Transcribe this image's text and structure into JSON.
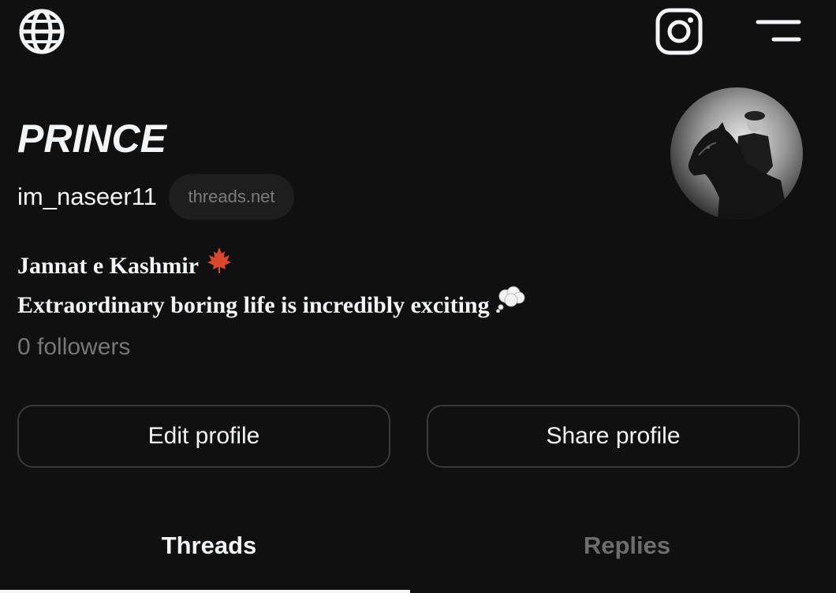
{
  "header": {
    "left_icon": "globe-icon",
    "right_icons": [
      "instagram-icon",
      "menu-icon"
    ]
  },
  "profile": {
    "display_name": "PRINCE",
    "username": "im_naseer11",
    "domain_badge": "threads.net",
    "bio_line1": "Jannat e Kashmir",
    "bio_line1_icon": "maple-leaf-icon",
    "bio_line2": "Extraordinary boring life is incredibly exciting",
    "bio_line2_icon": "thought-balloon-icon",
    "followers": "0 followers"
  },
  "buttons": {
    "edit_label": "Edit profile",
    "share_label": "Share profile"
  },
  "tabs": [
    {
      "label": "Threads",
      "active": true
    },
    {
      "label": "Replies",
      "active": false
    }
  ],
  "colors": {
    "background": "#101010",
    "text": "#f3f5f7",
    "muted": "#777777",
    "border": "#3a3a3a",
    "badge_bg": "#1e1e1e"
  }
}
